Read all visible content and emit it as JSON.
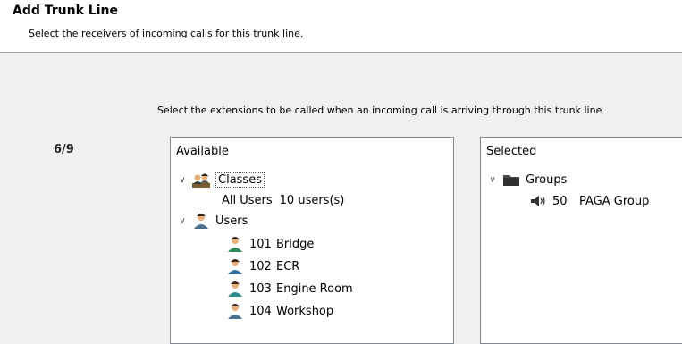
{
  "header": {
    "title": "Add Trunk Line",
    "subtitle": "Select the receivers of incoming calls for this trunk line."
  },
  "instruction": "Select the extensions to be called when an incoming call is arriving through this trunk line",
  "step": "6/9",
  "available": {
    "title": "Available",
    "classes_label": "Classes",
    "all_users_label": "All Users",
    "all_users_count": "10 users(s)",
    "users_label": "Users",
    "users": [
      {
        "number": "101",
        "name": "Bridge"
      },
      {
        "number": "102",
        "name": "ECR"
      },
      {
        "number": "103",
        "name": "Engine Room"
      },
      {
        "number": "104",
        "name": "Workshop"
      }
    ]
  },
  "selected": {
    "title": "Selected",
    "groups_label": "Groups",
    "group_item": {
      "number": "50",
      "name": "PAGA Group"
    }
  },
  "icons": {
    "expanded": "chevron-down-icon",
    "classes": "classes-icon",
    "users": "users-icon",
    "user": "user-icon",
    "groups": "folder-icon",
    "speaker": "speaker-icon"
  }
}
